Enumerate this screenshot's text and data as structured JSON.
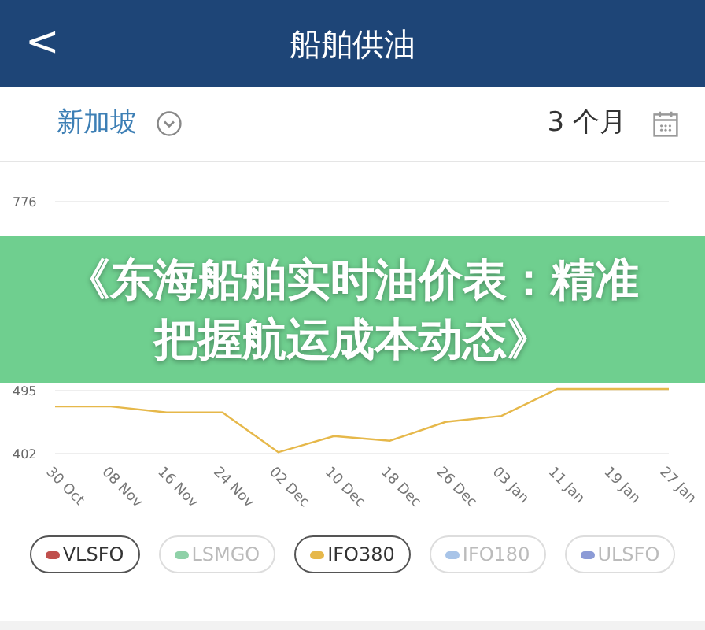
{
  "header": {
    "back": "<",
    "title": "船舶供油"
  },
  "filter": {
    "port": "新加坡",
    "period": "3 个月"
  },
  "chart": {
    "ylabels": [
      "776",
      "495",
      "402"
    ],
    "xlabels": [
      "30 Oct",
      "08 Nov",
      "16 Nov",
      "24 Nov",
      "02 Dec",
      "10 Dec",
      "18 Dec",
      "26 Dec",
      "03 Jan",
      "11 Jan",
      "19 Jan",
      "27 Jan"
    ]
  },
  "legend": [
    {
      "label": "VLSFO",
      "color": "#c0504d",
      "selected": true
    },
    {
      "label": "LSMGO",
      "color": "#8fd1a8",
      "selected": false
    },
    {
      "label": "IFO380",
      "color": "#e6b84a",
      "selected": true
    },
    {
      "label": "IFO180",
      "color": "#a8c4e8",
      "selected": false
    },
    {
      "label": "ULSFO",
      "color": "#8c9bd6",
      "selected": false
    }
  ],
  "banner": {
    "text": "《东海船舶实时油价表：精准把握航运成本动态》"
  }
}
